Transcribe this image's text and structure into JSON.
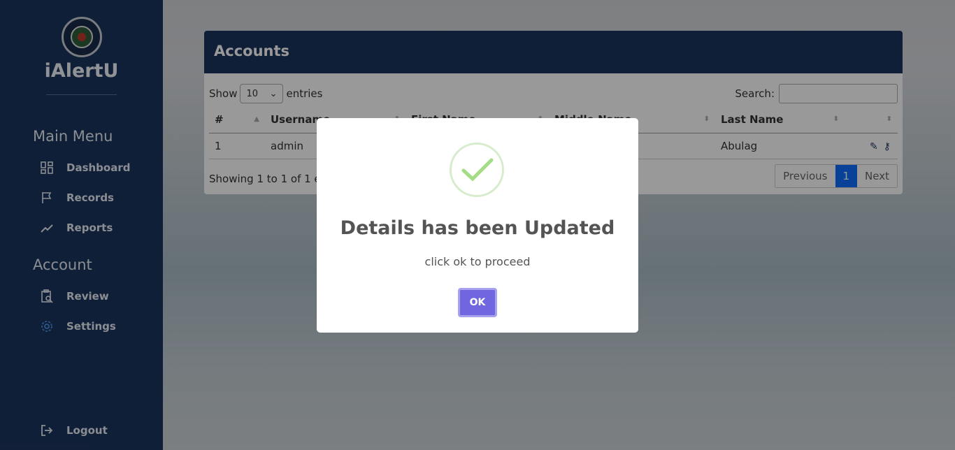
{
  "sidebar": {
    "brand": "iAlertU",
    "main_menu_title": "Main Menu",
    "account_title": "Account",
    "items": [
      {
        "label": "Dashboard",
        "icon": "dashboard-icon"
      },
      {
        "label": "Records",
        "icon": "flag-icon"
      },
      {
        "label": "Reports",
        "icon": "trend-line-icon"
      },
      {
        "label": "Review",
        "icon": "clipboard-search-icon"
      },
      {
        "label": "Settings",
        "icon": "gear-icon"
      },
      {
        "label": "Logout",
        "icon": "logout-icon"
      }
    ]
  },
  "card": {
    "title": "Accounts",
    "show_label": "Show",
    "entries_value": "10",
    "entries_label": "entries",
    "search_label": "Search:",
    "columns": [
      "#",
      "Username",
      "First Name",
      "Middle Name",
      "Last Name"
    ],
    "rows": [
      {
        "num": "1",
        "username": "admin",
        "first": "",
        "middle": "",
        "last": "Abulag"
      }
    ],
    "info": "Showing 1 to 1 of 1 entries",
    "pager": {
      "previous": "Previous",
      "page": "1",
      "next": "Next"
    }
  },
  "modal": {
    "title": "Details has been Updated",
    "text": "click ok to proceed",
    "ok_label": "OK"
  },
  "colors": {
    "sidebar": "#1c355e",
    "ok_button": "#7066e0",
    "success_check": "#a5dc86"
  }
}
